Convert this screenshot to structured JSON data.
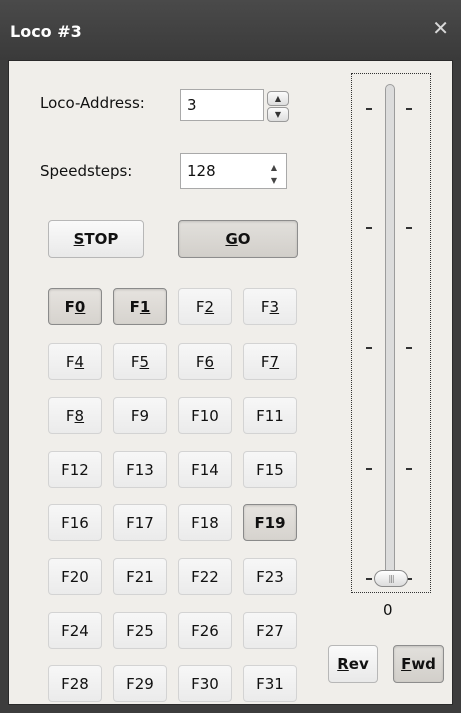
{
  "window": {
    "title": "Loco #3",
    "close_icon": "close-icon"
  },
  "address": {
    "label": "Loco-Address:",
    "value": "3"
  },
  "speedsteps": {
    "label": "Speedsteps:",
    "value": "128"
  },
  "buttons": {
    "stop": {
      "pre": "",
      "u": "S",
      "post": "TOP"
    },
    "go": {
      "pre": "",
      "u": "G",
      "post": "O"
    },
    "rev": {
      "pre": "",
      "u": "R",
      "post": "ev"
    },
    "fwd": {
      "pre": "",
      "u": "F",
      "post": "wd"
    }
  },
  "functions": [
    {
      "pre": "F",
      "u": "0",
      "post": "",
      "active": true
    },
    {
      "pre": "F",
      "u": "1",
      "post": "",
      "active": true
    },
    {
      "pre": "F",
      "u": "2",
      "post": "",
      "active": false
    },
    {
      "pre": "F",
      "u": "3",
      "post": "",
      "active": false
    },
    {
      "pre": "F",
      "u": "4",
      "post": "",
      "active": false
    },
    {
      "pre": "F",
      "u": "5",
      "post": "",
      "active": false
    },
    {
      "pre": "F",
      "u": "6",
      "post": "",
      "active": false
    },
    {
      "pre": "F",
      "u": "7",
      "post": "",
      "active": false
    },
    {
      "pre": "F",
      "u": "8",
      "post": "",
      "active": false
    },
    {
      "pre": "F9",
      "u": "",
      "post": "",
      "active": false
    },
    {
      "pre": "F10",
      "u": "",
      "post": "",
      "active": false
    },
    {
      "pre": "F11",
      "u": "",
      "post": "",
      "active": false
    },
    {
      "pre": "F12",
      "u": "",
      "post": "",
      "active": false
    },
    {
      "pre": "F13",
      "u": "",
      "post": "",
      "active": false
    },
    {
      "pre": "F14",
      "u": "",
      "post": "",
      "active": false
    },
    {
      "pre": "F15",
      "u": "",
      "post": "",
      "active": false
    },
    {
      "pre": "F16",
      "u": "",
      "post": "",
      "active": false
    },
    {
      "pre": "F17",
      "u": "",
      "post": "",
      "active": false
    },
    {
      "pre": "F18",
      "u": "",
      "post": "",
      "active": false
    },
    {
      "pre": "F19",
      "u": "",
      "post": "",
      "active": true
    },
    {
      "pre": "F20",
      "u": "",
      "post": "",
      "active": false
    },
    {
      "pre": "F21",
      "u": "",
      "post": "",
      "active": false
    },
    {
      "pre": "F22",
      "u": "",
      "post": "",
      "active": false
    },
    {
      "pre": "F23",
      "u": "",
      "post": "",
      "active": false
    },
    {
      "pre": "F24",
      "u": "",
      "post": "",
      "active": false
    },
    {
      "pre": "F25",
      "u": "",
      "post": "",
      "active": false
    },
    {
      "pre": "F26",
      "u": "",
      "post": "",
      "active": false
    },
    {
      "pre": "F27",
      "u": "",
      "post": "",
      "active": false
    },
    {
      "pre": "F28",
      "u": "",
      "post": "",
      "active": false
    },
    {
      "pre": "F29",
      "u": "",
      "post": "",
      "active": false
    },
    {
      "pre": "F30",
      "u": "",
      "post": "",
      "active": false
    },
    {
      "pre": "F31",
      "u": "",
      "post": "",
      "active": false
    }
  ],
  "speed": {
    "value": "0",
    "level": 0
  }
}
